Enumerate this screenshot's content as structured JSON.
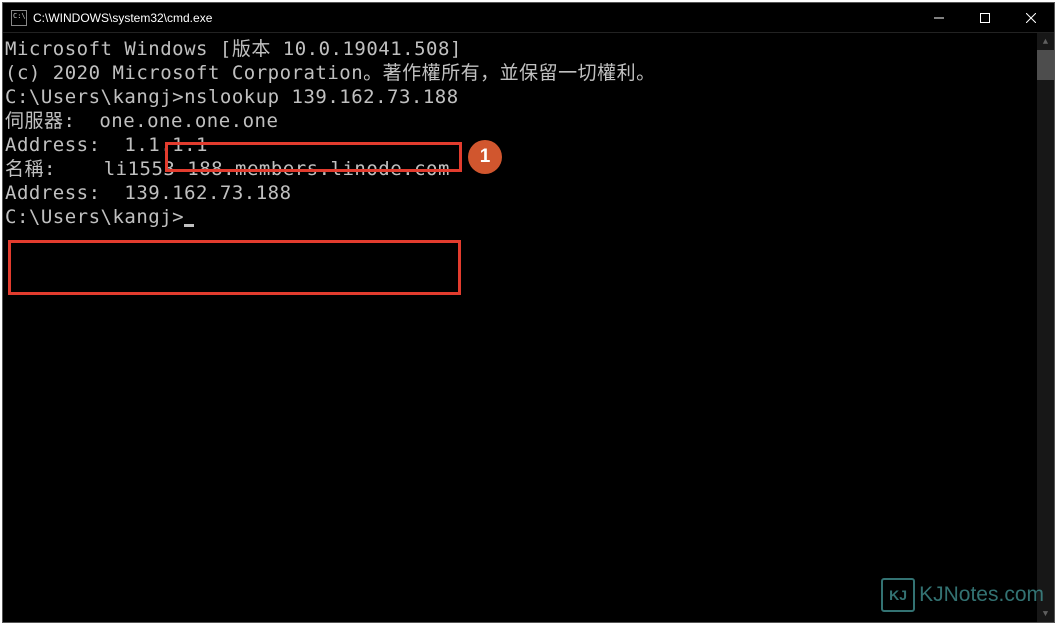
{
  "window": {
    "title": "C:\\WINDOWS\\system32\\cmd.exe"
  },
  "terminal": {
    "lines": {
      "l1": "Microsoft Windows [版本 10.0.19041.508]",
      "l2": "(c) 2020 Microsoft Corporation。著作權所有，並保留一切權利。",
      "l3": "",
      "l4": "C:\\Users\\kangj>nslookup 139.162.73.188",
      "l5": "伺服器:  one.one.one.one",
      "l6": "Address:  1.1.1.1",
      "l7": "",
      "l8": "名稱:    li1553-188.members.linode.com",
      "l9": "Address:  139.162.73.188",
      "l10": "",
      "l11": "",
      "l12": "C:\\Users\\kangj>"
    }
  },
  "annotation": {
    "callout1": "1"
  },
  "watermark": {
    "logo_text": "KJ",
    "text": "KJNotes.com"
  }
}
